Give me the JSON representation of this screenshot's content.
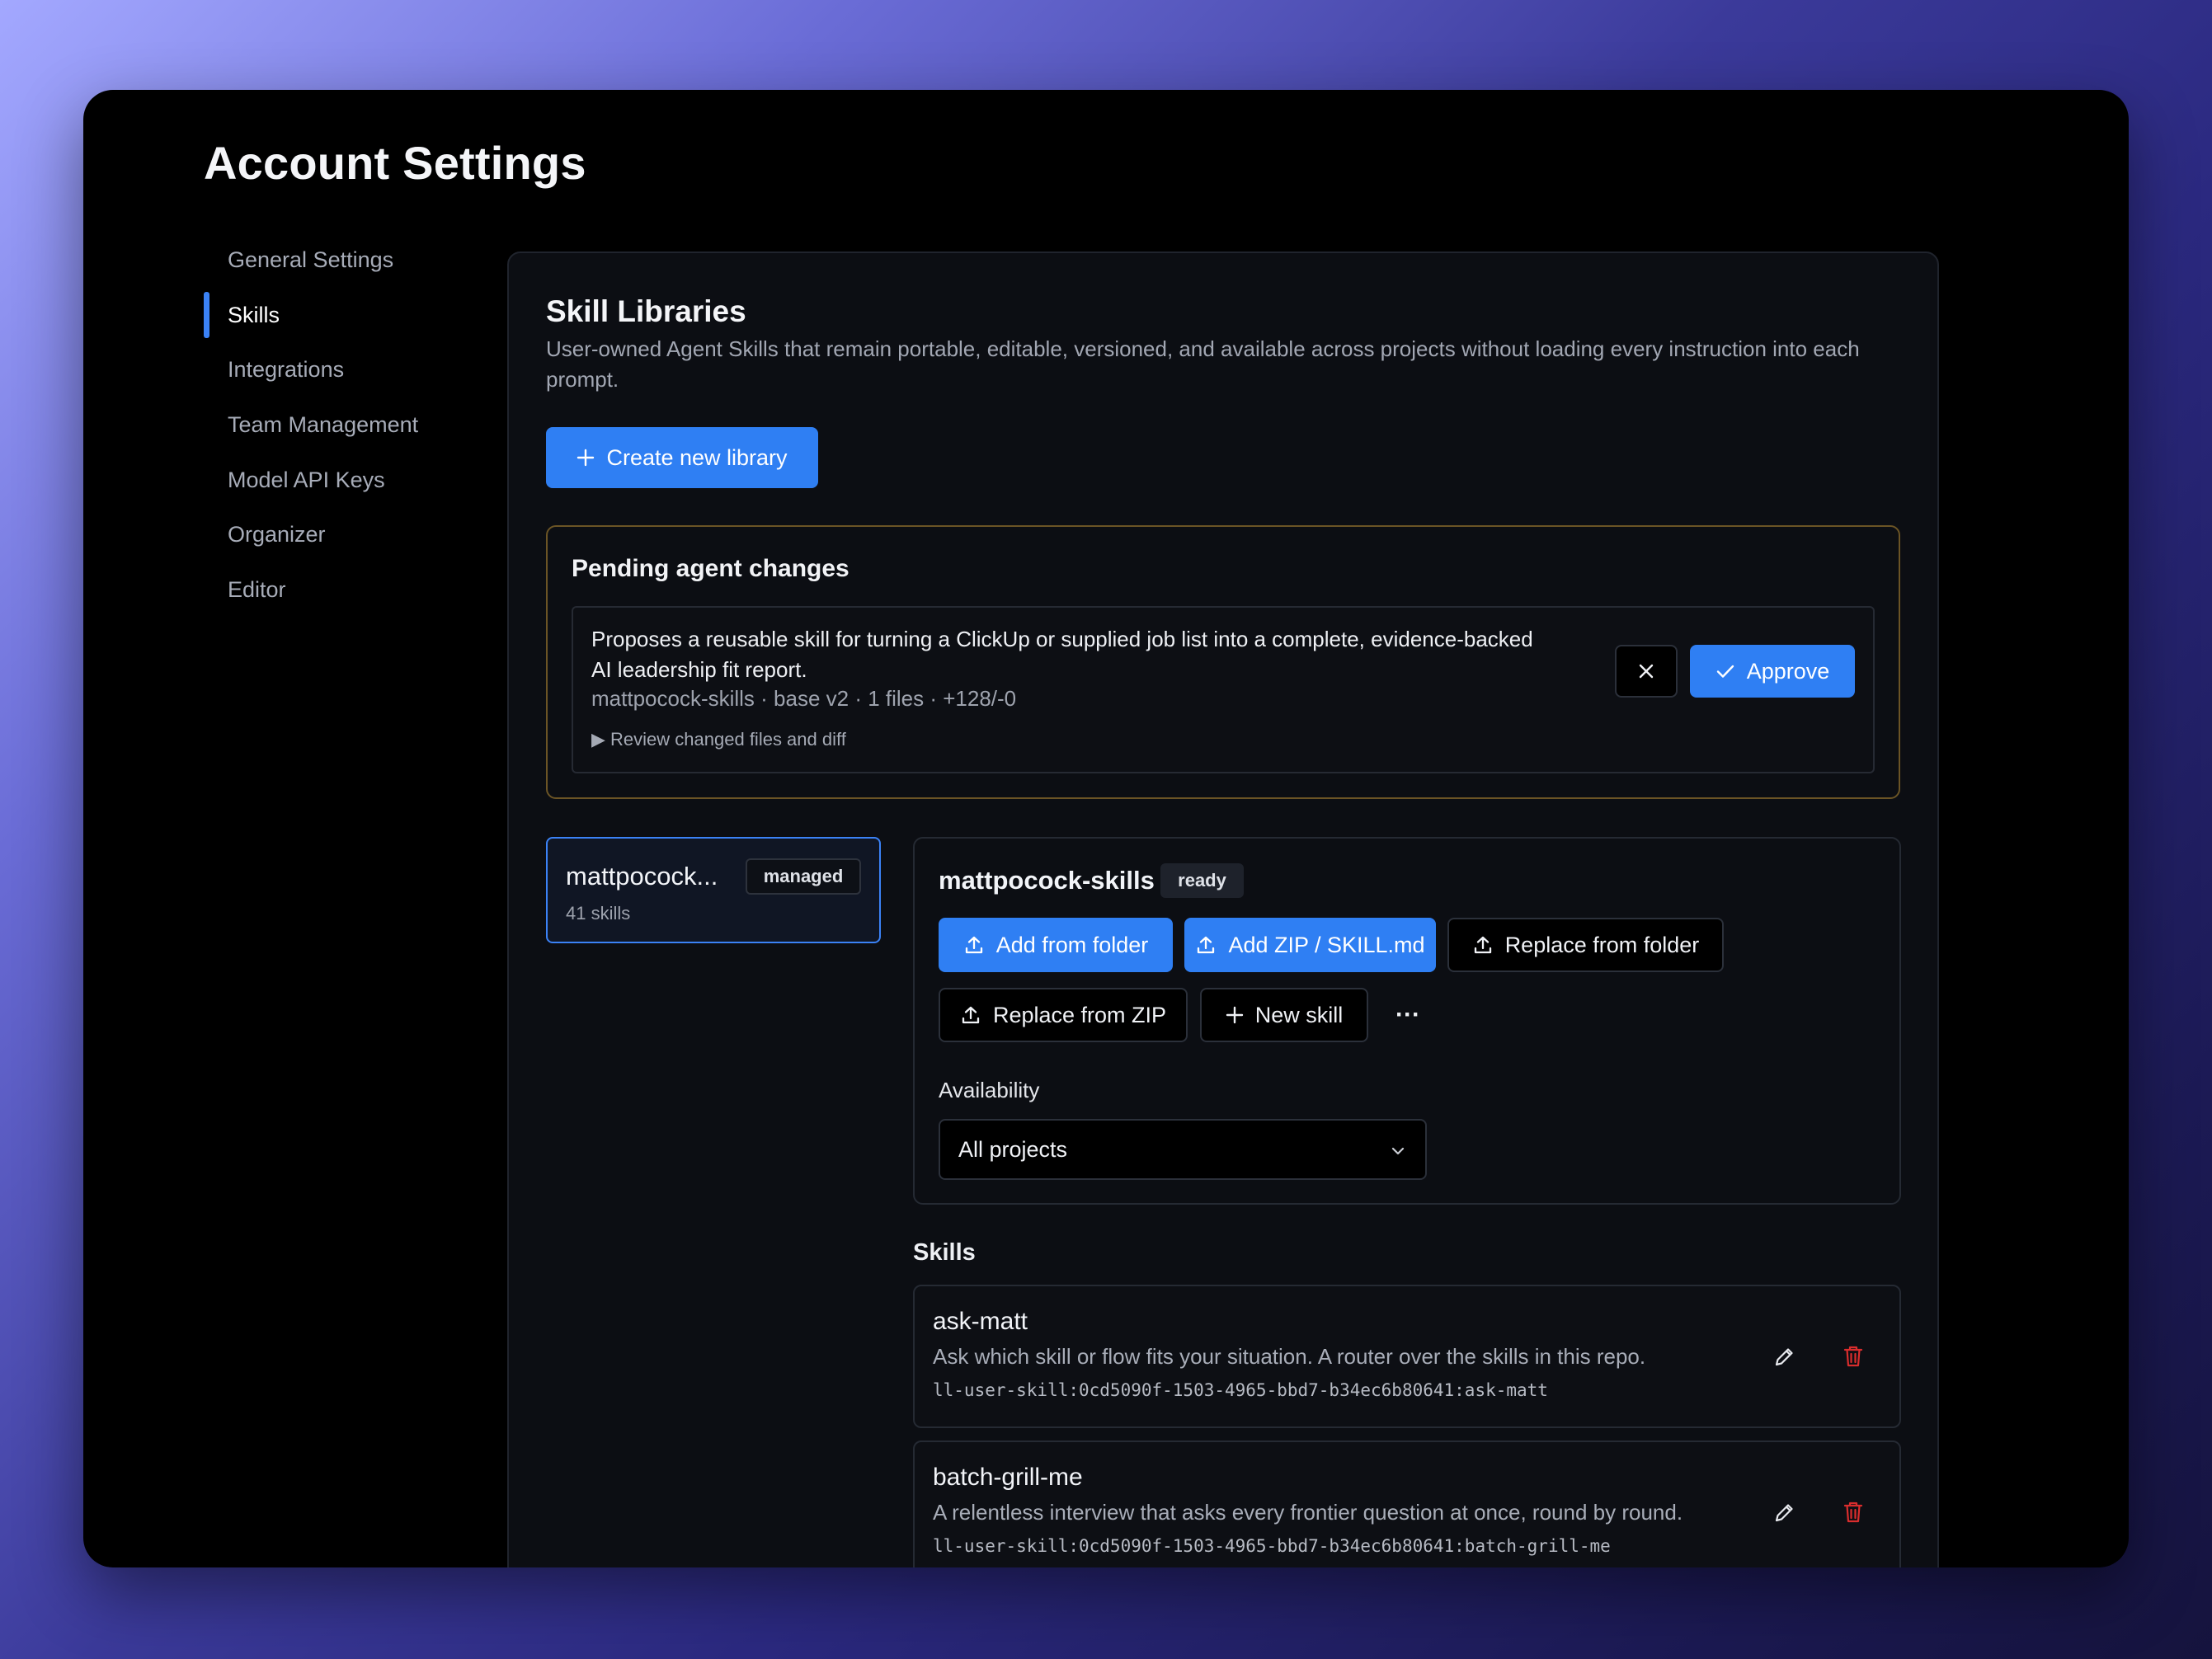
{
  "page": {
    "title": "Account Settings"
  },
  "sidebar": {
    "items": [
      {
        "label": "General Settings",
        "active": false
      },
      {
        "label": "Skills",
        "active": true
      },
      {
        "label": "Integrations",
        "active": false
      },
      {
        "label": "Team Management",
        "active": false
      },
      {
        "label": "Model API Keys",
        "active": false
      },
      {
        "label": "Organizer",
        "active": false
      },
      {
        "label": "Editor",
        "active": false
      }
    ]
  },
  "libraries": {
    "title": "Skill Libraries",
    "description": "User-owned Agent Skills that remain portable, editable, versioned, and available across projects without loading every instruction into each prompt.",
    "create_label": "Create new library"
  },
  "pending": {
    "title": "Pending agent changes",
    "description": "Proposes a reusable skill for turning a ClickUp or supplied job list into a complete, evidence-backed AI leadership fit report.",
    "meta": "mattpocock-skills · base v2 · 1 files · +128/-0",
    "review_label": "Review changed files and diff",
    "approve_label": "Approve"
  },
  "library_card": {
    "name": "mattpocock...",
    "badge": "managed",
    "count": "41 skills"
  },
  "detail": {
    "name": "mattpocock-skills",
    "status": "ready",
    "actions": {
      "add_folder": "Add from folder",
      "add_zip": "Add ZIP / SKILL.md",
      "replace_folder": "Replace from folder",
      "replace_zip": "Replace from ZIP",
      "new_skill": "New skill",
      "more": "···"
    },
    "availability_label": "Availability",
    "availability_value": "All projects"
  },
  "skills": {
    "title": "Skills",
    "items": [
      {
        "name": "ask-matt",
        "description": "Ask which skill or flow fits your situation. A router over the skills in this repo.",
        "id": "ll-user-skill:0cd5090f-1503-4965-bbd7-b34ec6b80641:ask-matt"
      },
      {
        "name": "batch-grill-me",
        "description": "A relentless interview that asks every frontier question at once, round by round.",
        "id": "ll-user-skill:0cd5090f-1503-4965-bbd7-b34ec6b80641:batch-grill-me"
      }
    ]
  },
  "colors": {
    "accent": "#2f7ff3",
    "danger": "#d92d2d",
    "pending_border": "#6b5425"
  },
  "icons": [
    "plus-icon",
    "close-icon",
    "check-icon",
    "upload-icon",
    "chevron-down-icon",
    "pencil-icon",
    "trash-icon",
    "ellipsis-icon"
  ]
}
